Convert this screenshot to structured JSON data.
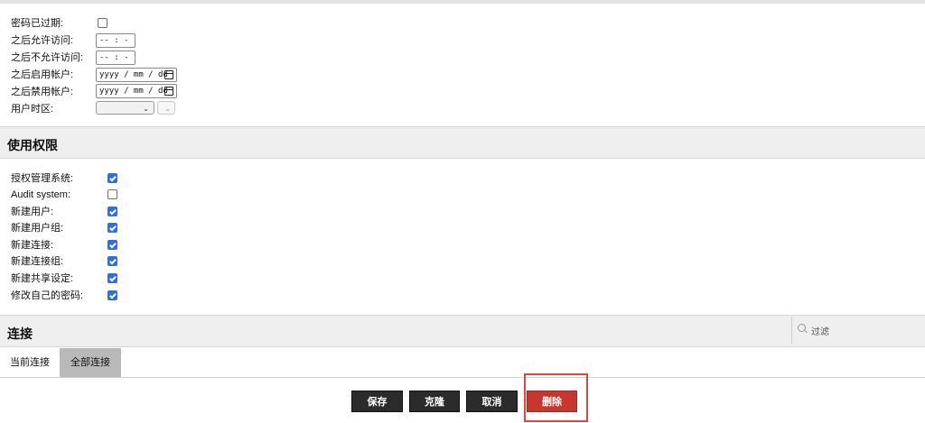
{
  "colors": {
    "accent_check": "#2f6fe0",
    "danger": "#c8372d",
    "dark_button": "#2b2b2b",
    "highlight": "#e2453c"
  },
  "account": {
    "password_expired_label": "密码已过期:",
    "allow_after_label": "之后允许访问:",
    "allow_after_value": "-- : --",
    "deny_after_label": "之后不允许访问:",
    "deny_after_value": "-- : --",
    "enable_after_label": "之后启用帐户:",
    "enable_after_value": "yyyy / mm / dd",
    "disable_after_label": "之后禁用帐户:",
    "disable_after_value": "yyyy / mm / dd",
    "timezone_label": "用户时区:",
    "password_expired_checked": false
  },
  "permissions": {
    "title": "使用权限",
    "items": [
      {
        "label": "授权管理系统:",
        "checked": true
      },
      {
        "label": "Audit system:",
        "checked": false
      },
      {
        "label": "新建用户:",
        "checked": true
      },
      {
        "label": "新建用户组:",
        "checked": true
      },
      {
        "label": "新建连接:",
        "checked": true
      },
      {
        "label": "新建连接组:",
        "checked": true
      },
      {
        "label": "新建共享设定:",
        "checked": true
      },
      {
        "label": "修改自己的密码:",
        "checked": true
      }
    ]
  },
  "connections": {
    "title": "连接",
    "filter_placeholder": "过滤",
    "tabs": [
      {
        "label": "当前连接",
        "active": false
      },
      {
        "label": "全部连接",
        "active": true
      }
    ]
  },
  "actions": {
    "save": "保存",
    "clone": "克隆",
    "cancel": "取消",
    "delete": "删除"
  }
}
